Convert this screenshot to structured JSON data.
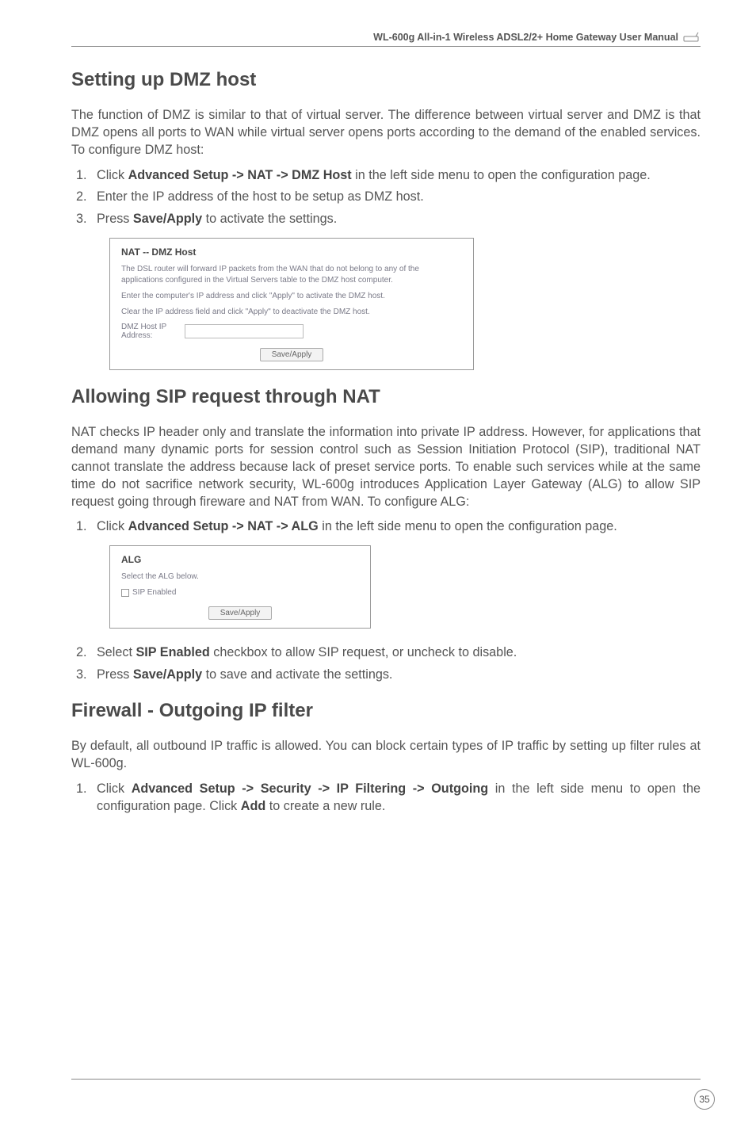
{
  "header": {
    "title": "WL-600g All-in-1 Wireless ADSL2/2+ Home Gateway User Manual"
  },
  "section1": {
    "title": "Setting up DMZ host",
    "intro": "The function of DMZ is similar to that of virtual server. The difference between virtual server and DMZ is that DMZ opens all ports to WAN while virtual server opens ports according to the demand of the enabled services. To configure DMZ host:",
    "step1a": "Click ",
    "step1b": "Advanced Setup -> NAT -> DMZ Host",
    "step1c": " in the left side menu to open the configuration page.",
    "step2": "Enter the IP address of the host to be setup as DMZ host.",
    "step3a": "Press ",
    "step3b": "Save/Apply",
    "step3c": " to activate the settings.",
    "shot": {
      "title": "NAT -- DMZ Host",
      "line1": "The DSL router will forward IP packets from the WAN that do not belong to any of the applications configured in the Virtual Servers table to the DMZ host computer.",
      "line2": "Enter the computer's IP address and click \"Apply\" to activate the DMZ host.",
      "line3": "Clear the IP address field and click \"Apply\" to deactivate the DMZ host.",
      "label": "DMZ Host IP Address:",
      "btn": "Save/Apply"
    }
  },
  "section2": {
    "title": "Allowing SIP request through NAT",
    "intro": "NAT checks IP header only and translate the information into private IP address. However, for applications that demand many dynamic ports for session control such as Session Initiation Protocol (SIP), traditional NAT cannot translate the address because lack of preset service ports. To enable such services while at the same time do not sacrifice network security, WL-600g introduces Application Layer Gateway (ALG) to allow SIP request going through fireware and NAT from WAN. To configure ALG:",
    "step1a": "Click ",
    "step1b": "Advanced Setup -> NAT -> ALG",
    "step1c": " in the left side menu to open the configuration page.",
    "shot": {
      "title": "ALG",
      "line1": "Select the ALG below.",
      "chk": "SIP Enabled",
      "btn": "Save/Apply"
    },
    "step2a": "Select ",
    "step2b": "SIP Enabled",
    "step2c": " checkbox to allow SIP request, or uncheck to disable.",
    "step3a": "Press ",
    "step3b": "Save/Apply",
    "step3c": " to save and activate the settings."
  },
  "section3": {
    "title": "Firewall - Outgoing IP filter",
    "intro": "By default, all outbound IP traffic is allowed. You can block certain types of IP traffic by setting up filter rules at WL-600g.",
    "step1a": "Click ",
    "step1b": "Advanced Setup -> Security -> IP Filtering -> Outgoing",
    "step1c": " in the left side menu to open the configuration page. Click ",
    "step1d": "Add",
    "step1e": " to create a new rule."
  },
  "pagenum": "35"
}
